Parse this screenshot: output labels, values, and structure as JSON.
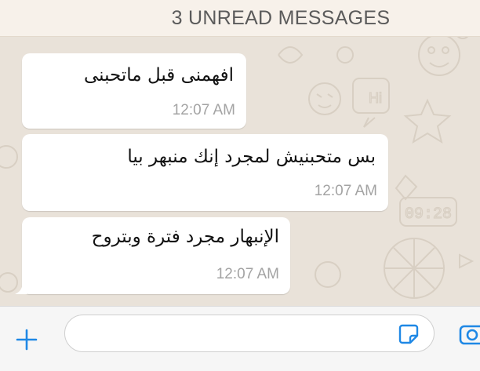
{
  "banner": {
    "text": "3 UNREAD MESSAGES"
  },
  "messages": [
    {
      "text": "افهمنى قبل ماتحبنى",
      "time": "12:07 AM"
    },
    {
      "text": "بس متحبنيش لمجرد إنك منبهر بيا",
      "time": "12:07 AM"
    },
    {
      "text": "الإنبهار مجرد فترة وبتروح",
      "time": "12:07 AM"
    }
  ],
  "input_bar": {
    "placeholder": "",
    "icons": {
      "attach": "plus-icon",
      "sticker": "sticker-icon",
      "camera": "camera-icon"
    }
  },
  "colors": {
    "accent": "#1f88e5",
    "chat_background": "#e9e2d9",
    "bubble": "#ffffff",
    "banner_background": "#f7f1ea"
  }
}
